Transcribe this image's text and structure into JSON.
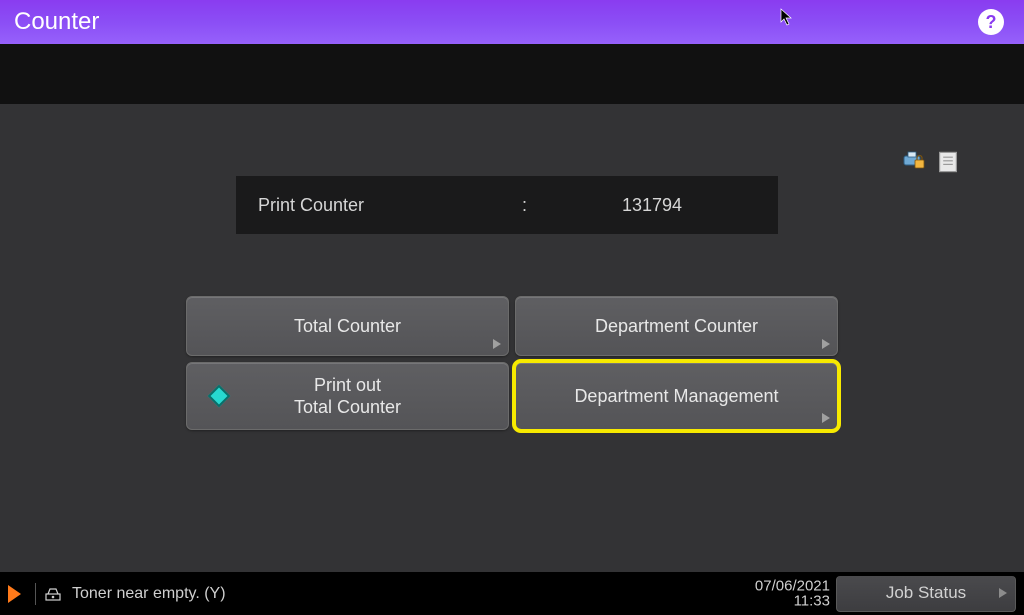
{
  "header": {
    "title": "Counter",
    "help_label": "?"
  },
  "counter": {
    "label": "Print Counter",
    "separator": ":",
    "value": "131794"
  },
  "status_icons": {
    "printer_locked": "printer-locked-icon",
    "document": "document-icon"
  },
  "buttons": {
    "total_counter": "Total Counter",
    "department_counter": "Department Counter",
    "print_out_line1": "Print out",
    "print_out_line2": "Total Counter",
    "department_management": "Department Management"
  },
  "footer": {
    "message": "Toner near empty. (Y)",
    "date": "07/06/2021",
    "time": "11:33",
    "job_status": "Job Status"
  }
}
